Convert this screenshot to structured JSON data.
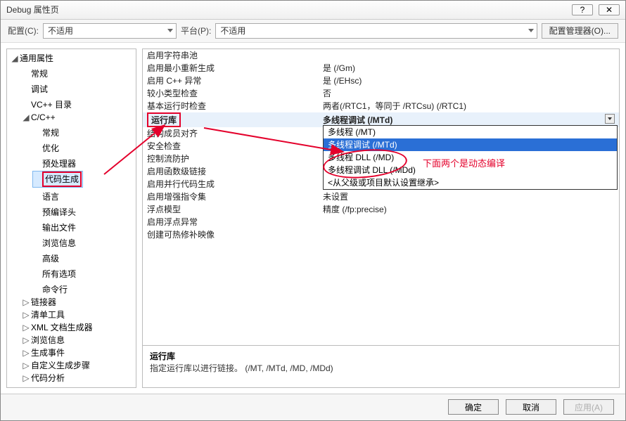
{
  "title": "Debug 属性页",
  "configbar": {
    "config_label": "配置(C):",
    "config_value": "不适用",
    "platform_label": "平台(P):",
    "platform_value": "不适用",
    "manager_btn": "配置管理器(O)..."
  },
  "tree": {
    "root": "通用属性",
    "items_a": [
      "常规",
      "调试",
      "VC++ 目录"
    ],
    "cpp": "C/C++",
    "cpp_items": [
      "常规",
      "优化",
      "预处理器",
      "代码生成",
      "语言",
      "预编译头",
      "输出文件",
      "浏览信息",
      "高级",
      "所有选项",
      "命令行"
    ],
    "rest": [
      "链接器",
      "清单工具",
      "XML 文档生成器",
      "浏览信息",
      "生成事件",
      "自定义生成步骤",
      "代码分析"
    ]
  },
  "grid": [
    {
      "name": "启用字符串池",
      "value": ""
    },
    {
      "name": "启用最小重新生成",
      "value": "是 (/Gm)"
    },
    {
      "name": "启用 C++ 异常",
      "value": "是 (/EHsc)"
    },
    {
      "name": "较小类型检查",
      "value": "否"
    },
    {
      "name": "基本运行时检查",
      "value": "两者(/RTC1，等同于 /RTCsu) (/RTC1)"
    },
    {
      "name": "运行库",
      "value": "多线程调试 (/MTd)"
    },
    {
      "name": "结构成员对齐",
      "value": ""
    },
    {
      "name": "安全检查",
      "value": ""
    },
    {
      "name": "控制流防护",
      "value": ""
    },
    {
      "name": "启用函数级链接",
      "value": ""
    },
    {
      "name": "启用并行代码生成",
      "value": ""
    },
    {
      "name": "启用增强指令集",
      "value": "未设置"
    },
    {
      "name": "浮点模型",
      "value": "精度 (/fp:precise)"
    },
    {
      "name": "启用浮点异常",
      "value": ""
    },
    {
      "name": "创建可热修补映像",
      "value": ""
    }
  ],
  "dropdown": [
    "多线程 (/MT)",
    "多线程调试 (/MTd)",
    "多线程 DLL (/MD)",
    "多线程调试 DLL (/MDd)",
    "<从父级或项目默认设置继承>"
  ],
  "annotation": "下面两个是动态编译",
  "desc": {
    "title": "运行库",
    "body": "指定运行库以进行链接。     (/MT, /MTd, /MD, /MDd)"
  },
  "buttons": {
    "ok": "确定",
    "cancel": "取消",
    "apply": "应用(A)"
  }
}
